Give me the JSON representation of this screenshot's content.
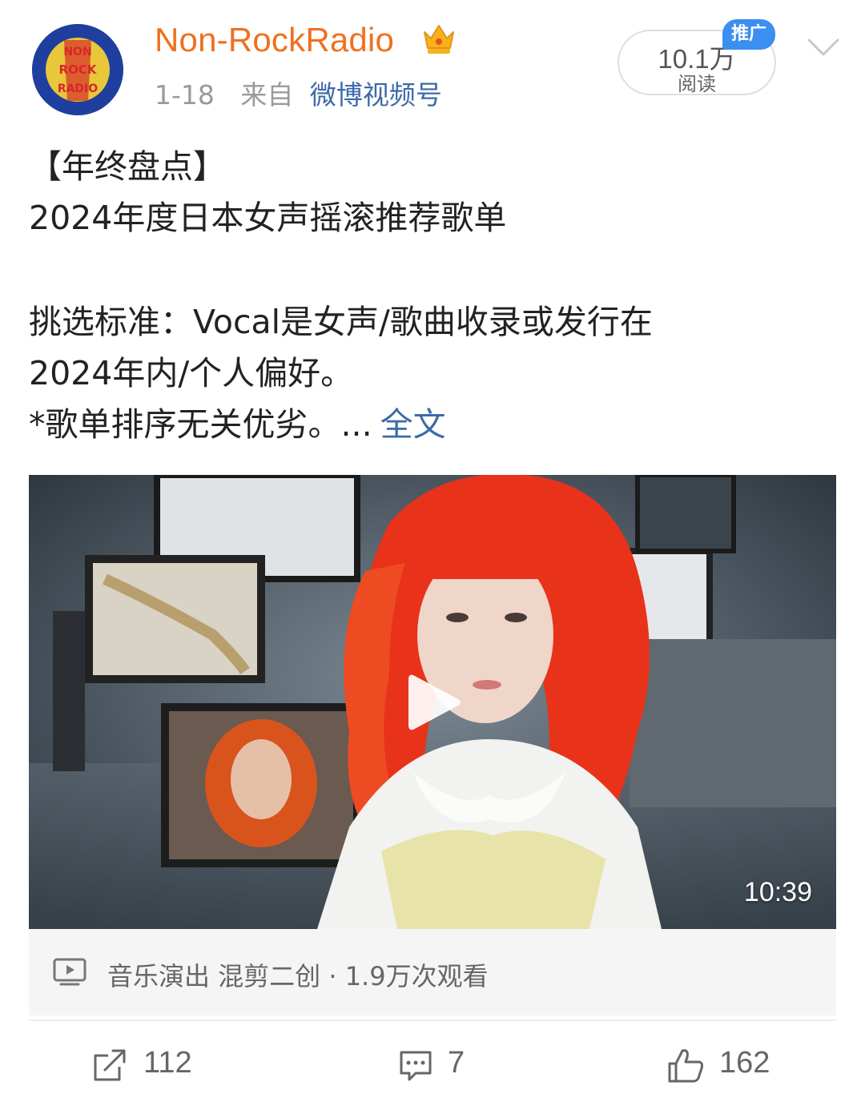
{
  "header": {
    "username": "Non-RockRadio",
    "avatar_text": [
      "NON",
      "ROCK",
      "RADIO"
    ],
    "date": "1-18",
    "from_label": "来自",
    "source": "微博视频号",
    "read_count": "10.1万",
    "read_label": "阅读",
    "promo_badge": "推广",
    "icons": {
      "vip": "crown-icon",
      "menu": "chevron-down-icon"
    }
  },
  "post": {
    "line1": "【年终盘点】",
    "line2": "2024年度日本女声摇滚推荐歌单",
    "line3": "挑选标准：Vocal是女声/歌曲收录或发行在",
    "line4": "2024年内/个人偏好。",
    "line5": "*歌单排序无关优劣。...",
    "fulltext_link": "全文"
  },
  "video": {
    "duration": "10:39",
    "info": "音乐演出 混剪二创 · 1.9万次观看",
    "icons": {
      "play": "play-icon",
      "info": "video-tv-icon"
    }
  },
  "actions": {
    "repost_count": "112",
    "comment_count": "7",
    "like_count": "162"
  },
  "colors": {
    "username": "#f0701f",
    "link": "#3d6aa8",
    "badge": "#3c8ef0",
    "hair": "#e8321a"
  }
}
